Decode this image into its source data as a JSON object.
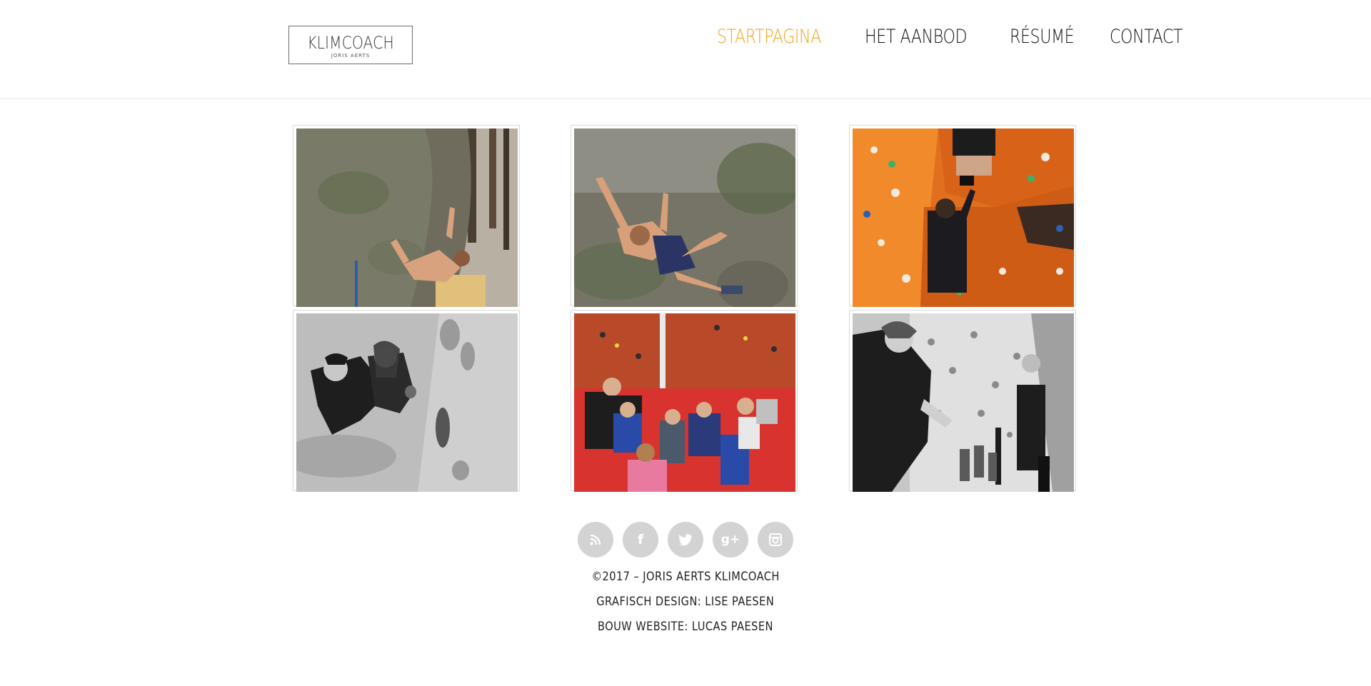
{
  "logo": {
    "title": "KLIMCOACH",
    "subtitle": "JORIS AERTS"
  },
  "nav": {
    "items": [
      {
        "label": "STARTPAGINA",
        "active": true
      },
      {
        "label": "HET AANBOD",
        "active": false
      },
      {
        "label": "RÉSUMÉ",
        "active": false
      },
      {
        "label": "CONTACT",
        "active": false
      }
    ]
  },
  "gallery": {
    "photos": [
      {
        "desc": "outdoor-boulder-climber"
      },
      {
        "desc": "overhang-boulder-climber"
      },
      {
        "desc": "orange-wall-climbers"
      },
      {
        "desc": "bw-couple-climbing"
      },
      {
        "desc": "kids-group-red-hall"
      },
      {
        "desc": "bw-coach-kids"
      }
    ]
  },
  "social": {
    "items": [
      {
        "name": "rss-icon",
        "glyph": "☰"
      },
      {
        "name": "facebook-icon",
        "glyph": "f"
      },
      {
        "name": "twitter-icon",
        "glyph": "t"
      },
      {
        "name": "google-plus-icon",
        "glyph": "g+"
      },
      {
        "name": "instagram-icon",
        "glyph": "◎"
      }
    ]
  },
  "footer": {
    "copyright": "©2017 – JORIS AERTS KLIMCOACH",
    "design_prefix": "GRAFISCH DESIGN: ",
    "design_name": "LISE PAESEN",
    "build_prefix": "BOUW WEBSITE: ",
    "build_name": "LUCAS PAESEN"
  },
  "colors": {
    "accent": "#f5a21a",
    "text": "#111111",
    "social_bg": "#d3d3d3"
  }
}
